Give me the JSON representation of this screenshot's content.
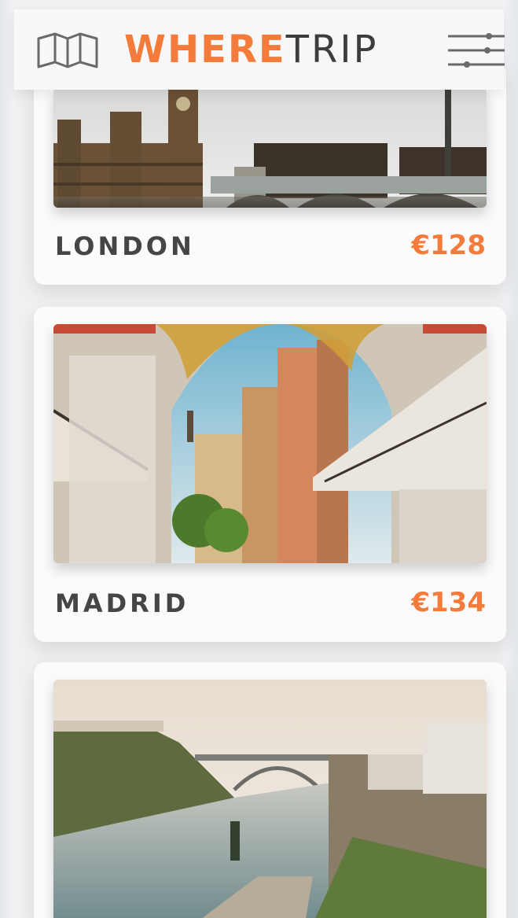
{
  "header": {
    "logo_where": "WHERE",
    "logo_trip": "TRIP",
    "map_icon": "folded-map-icon",
    "filter_icon": "sliders-icon"
  },
  "colors": {
    "accent": "#f47b3a",
    "text_dark": "#454545",
    "background": "#eef0f2"
  },
  "destinations": [
    {
      "city": "LONDON",
      "price": "€128",
      "image": "london-westminster-photo"
    },
    {
      "city": "MADRID",
      "price": "€134",
      "image": "madrid-arch-street-photo"
    },
    {
      "city": "",
      "price": "",
      "image": "porto-river-photo"
    }
  ]
}
